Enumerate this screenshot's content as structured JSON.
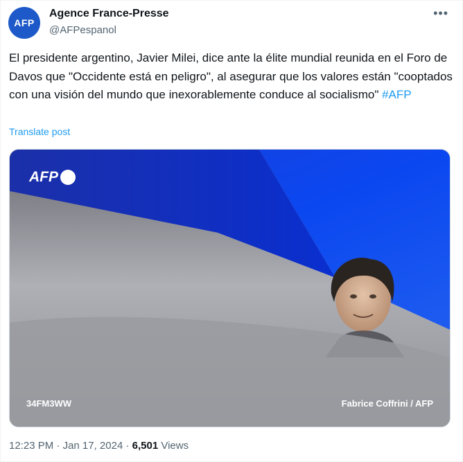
{
  "author": {
    "avatar_text": "AFP",
    "name": "Agence France-Presse",
    "handle": "@AFPespanol"
  },
  "more_icon": "more-horizontal-icon",
  "tweet": {
    "text": "El presidente argentino, Javier Milei, dice ante la élite mundial reunida en el Foro de Davos que \"Occidente está en peligro\", al asegurar que los valores están \"cooptados con una visión del mundo que inexorablemente conduce al socialismo\" ",
    "hashtag": "#AFP",
    "translate_label": "Translate post"
  },
  "media": {
    "logo_text": "AFP",
    "code": "34FM3WW",
    "credit": "Fabrice Coffrini / AFP"
  },
  "meta": {
    "time": "12:23 PM",
    "separator1": " · ",
    "date": "Jan 17, 2024",
    "separator2": " · ",
    "views_count": "6,501",
    "views_label": " Views"
  },
  "colors": {
    "link": "#1d9bf0",
    "avatar_bg": "#1d59c8",
    "secondary_text": "#536471"
  }
}
